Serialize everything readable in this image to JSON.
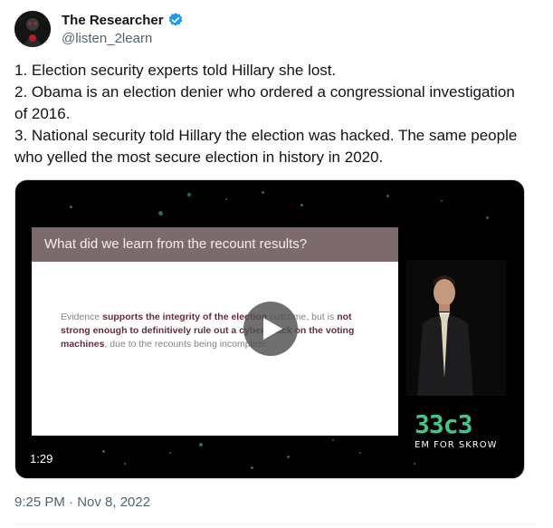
{
  "author": {
    "display_name": "The Researcher",
    "handle": "@listen_2learn",
    "verified": true,
    "verified_color": "#1d9bf0"
  },
  "tweet": {
    "lines": [
      "1. Election security experts told Hillary she lost.",
      "2. Obama is an election denier who ordered a congressional investigation of 2016.",
      "3. National security told Hillary the election was hacked. The same people who yelled the most secure election in history in 2020."
    ],
    "timestamp": "9:25 PM · Nov 8, 2022"
  },
  "video": {
    "duration": "1:29",
    "slide_title": "What did we learn from the recount results?",
    "slide_body": {
      "p1": "Evidence ",
      "b1": "supports the integrity of the election",
      "p2": " outcome, but is ",
      "b2": "not strong enough to definitively rule out a cyberattack on the voting machines",
      "p3": ", due to the recounts being incomplete."
    },
    "logo_text": "33c3",
    "logo_mirror_text": "EM FOR SKROW",
    "play_icon": "play-icon"
  }
}
